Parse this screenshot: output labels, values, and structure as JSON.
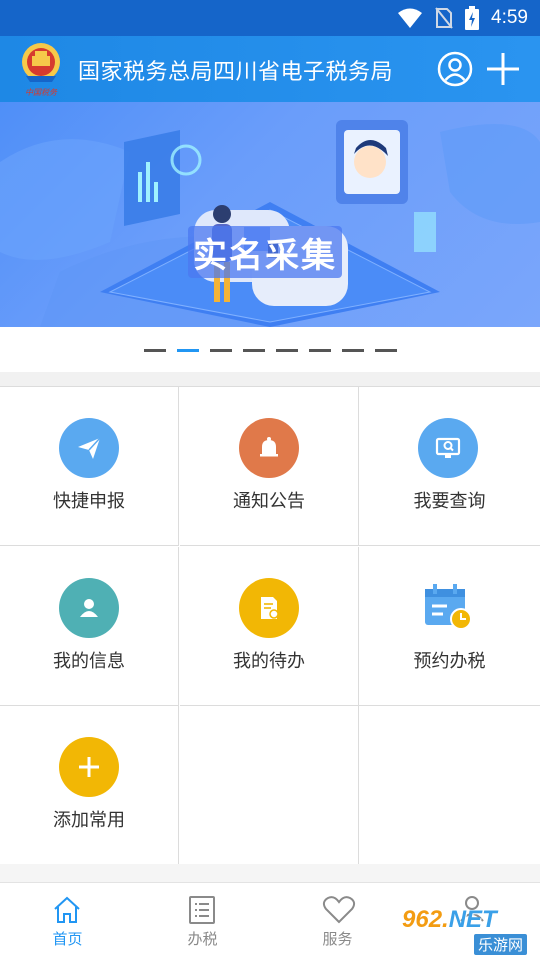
{
  "status_bar": {
    "time": "4:59"
  },
  "header": {
    "title": "国家税务总局四川省电子税务局"
  },
  "banner": {
    "title": "实名采集",
    "slide_count": 8,
    "active_slide": 2
  },
  "grid": {
    "items": [
      {
        "label": "快捷申报",
        "icon": "paper-plane-icon",
        "color": "#5aa9f0"
      },
      {
        "label": "通知公告",
        "icon": "bell-icon",
        "color": "#e0794a"
      },
      {
        "label": "我要查询",
        "icon": "monitor-search-icon",
        "color": "#5aa9f0"
      },
      {
        "label": "我的信息",
        "icon": "person-icon",
        "color": "#4fb0b4"
      },
      {
        "label": "我的待办",
        "icon": "document-clock-icon",
        "color": "#f2b705"
      },
      {
        "label": "预约办税",
        "icon": "calendar-clock-icon",
        "color": "#5aa9f0"
      },
      {
        "label": "添加常用",
        "icon": "plus-icon",
        "color": "#f2b705"
      }
    ]
  },
  "bottom_nav": {
    "items": [
      {
        "label": "首页",
        "icon": "home-icon",
        "active": true
      },
      {
        "label": "办税",
        "icon": "list-icon",
        "active": false
      },
      {
        "label": "服务",
        "icon": "heart-icon",
        "active": false
      }
    ]
  },
  "watermark": {
    "top": "962.NET",
    "bottom": "乐游网"
  },
  "colors": {
    "header": "#1e88e5",
    "status_bar": "#1565c9",
    "accent": "#2196f3"
  }
}
